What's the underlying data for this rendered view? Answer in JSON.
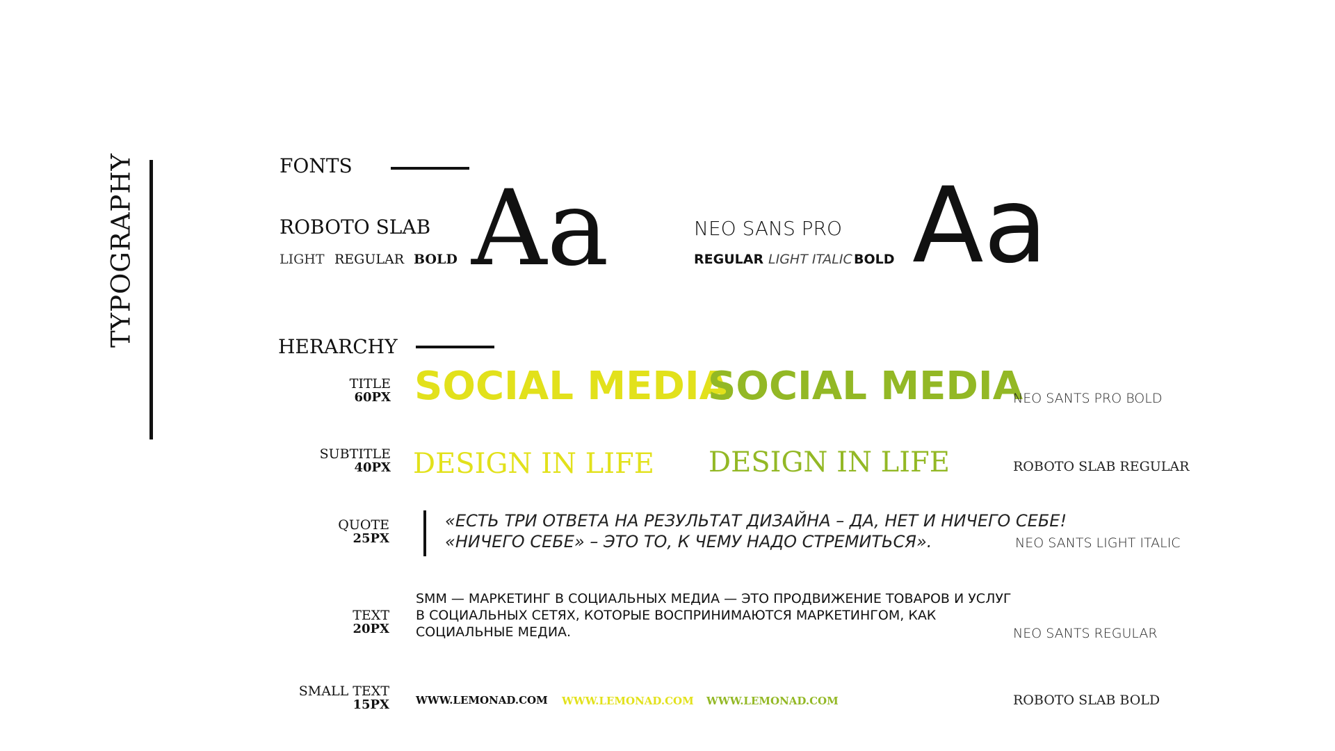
{
  "page": {
    "vertical_title": "TYPOGRAPHY"
  },
  "fonts": {
    "title": "FONTS",
    "font1": {
      "name": "ROBOTO SLAB",
      "weights": [
        "LIGHT",
        "REGULAR",
        "BOLD"
      ],
      "sample": "Aa"
    },
    "font2": {
      "name": "NEO SANS PRO",
      "weights": [
        "REGULAR",
        "LIGHT ITALIC",
        "BOLD"
      ],
      "sample": "Aa"
    }
  },
  "hierarchy": {
    "title": "HERARCHY",
    "rows": {
      "title": {
        "label": "TITLE",
        "size": "60PX",
        "sample": "SOCIAL MEDIA",
        "font": "NEO SANTS PRO BOLD"
      },
      "subtitle": {
        "label": "SUBTITLE",
        "size": "40PX",
        "sample": "DESIGN IN LIFE",
        "font": "ROBOTO SLAB REGULAR"
      },
      "quote": {
        "label": "QUOTE",
        "size": "25PX",
        "lines": [
          "«ЕСТЬ ТРИ ОТВЕТА НА РЕЗУЛЬТАТ ДИЗАЙНА – ДА, НЕТ И НИЧЕГО СЕБЕ!",
          "«НИЧЕГО СЕБЕ» – ЭТО ТО, К ЧЕМУ НАДО СТРЕМИТЬСЯ»."
        ],
        "font": "NEO SANTS LIGHT ITALIC"
      },
      "text": {
        "label": "TEXT",
        "size": "20PX",
        "lines": [
          "SMM — МАРКЕТИНГ В СОЦИАЛЬНЫХ МЕДИА — ЭТО ПРОДВИЖЕНИЕ ТОВАРОВ И УСЛУГ",
          "В СОЦИАЛЬНЫХ СЕТЯХ, КОТОРЫЕ ВОСПРИНИМАЮТСЯ МАРКЕТИНГОМ, КАК",
          "СОЦИАЛЬНЫЕ МЕДИА."
        ],
        "font": "NEO SANTS REGULAR"
      },
      "small": {
        "label": "SMALL TEXT",
        "size": "15PX",
        "sample": "WWW.LEMONAD.COM",
        "font": "ROBOTO SLAB BOLD"
      }
    }
  },
  "colors": {
    "black": "#111111",
    "yellow": "#e2e11b",
    "green": "#93b825"
  }
}
